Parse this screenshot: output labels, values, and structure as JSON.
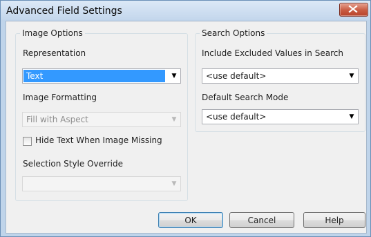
{
  "window": {
    "title": "Advanced Field Settings",
    "close_icon": "close-icon"
  },
  "image_options": {
    "legend": "Image Options",
    "representation_label": "Representation",
    "representation_value": "Text",
    "image_formatting_label": "Image Formatting",
    "image_formatting_value": "Fill with Aspect",
    "hide_text_label": "Hide Text When Image Missing",
    "hide_text_checked": false,
    "selection_style_label": "Selection Style Override",
    "selection_style_value": ""
  },
  "search_options": {
    "legend": "Search Options",
    "include_excluded_label": "Include Excluded Values in Search",
    "include_excluded_value": "<use default>",
    "default_search_mode_label": "Default Search Mode",
    "default_search_mode_value": "<use default>"
  },
  "buttons": {
    "ok": "OK",
    "cancel": "Cancel",
    "help": "Help"
  },
  "colors": {
    "selection_highlight": "#3399ff",
    "close_button": "#c85a41",
    "window_frame": "#bfd4ea"
  }
}
